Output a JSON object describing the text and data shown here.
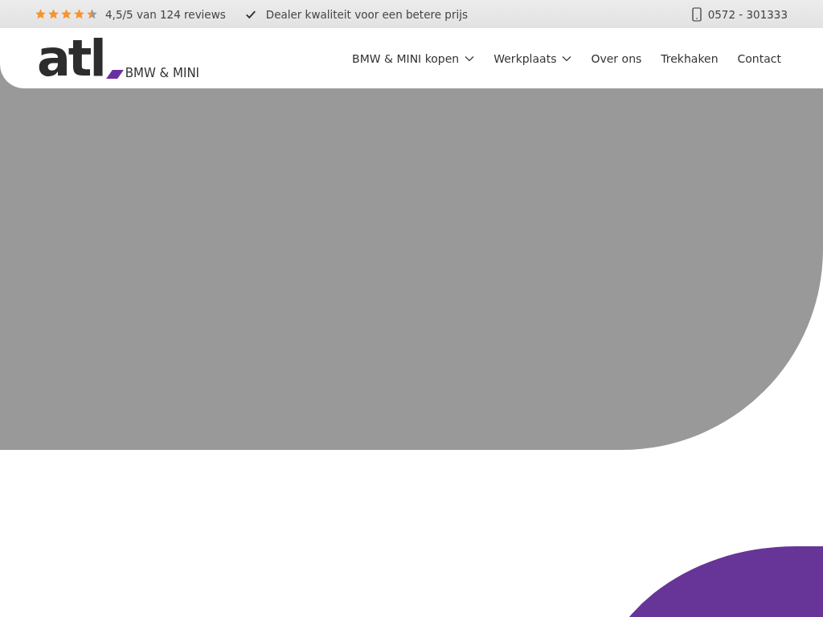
{
  "top_bar": {
    "rating": {
      "stars": 4.5,
      "text": "4,5/5 van 124 reviews"
    },
    "usp": "Dealer kwaliteit voor een betere prijs",
    "phone": "0572 - 301333"
  },
  "header": {
    "logo": {
      "mark": "atl",
      "subtitle": "BMW & MINI"
    },
    "nav": [
      {
        "label": "BMW & MINI kopen",
        "dropdown": true
      },
      {
        "label": "Werkplaats",
        "dropdown": true
      },
      {
        "label": "Over ons",
        "dropdown": false
      },
      {
        "label": "Trekhaken",
        "dropdown": false
      },
      {
        "label": "Contact",
        "dropdown": false
      }
    ]
  }
}
